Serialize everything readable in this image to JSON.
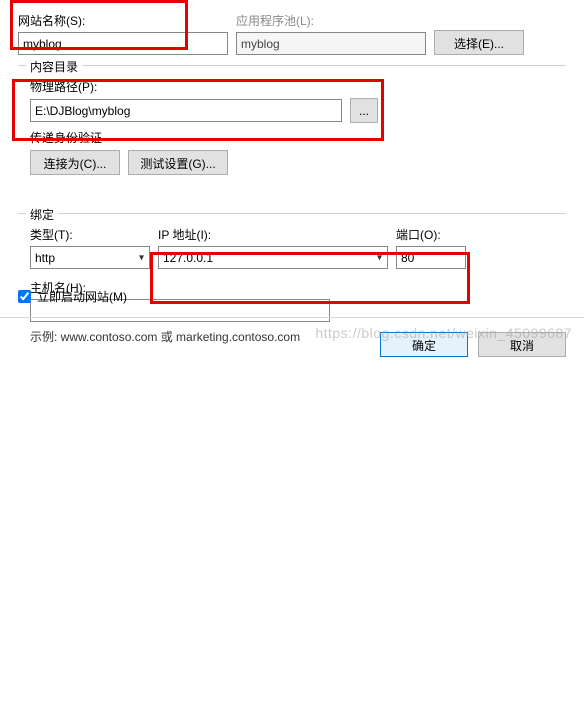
{
  "siteName": {
    "label": "网站名称(S):",
    "value": "myblog"
  },
  "appPool": {
    "label": "应用程序池(L):",
    "value": "myblog",
    "selectBtn": "选择(E)..."
  },
  "content": {
    "groupLabel": "内容目录",
    "pathLabel": "物理路径(P):",
    "pathValue": "E:\\DJBlog\\myblog",
    "browse": "...",
    "authLabel": "传递身份验证",
    "connectAs": "连接为(C)...",
    "testSettings": "测试设置(G)..."
  },
  "binding": {
    "groupLabel": "绑定",
    "typeLabel": "类型(T):",
    "typeValue": "http",
    "ipLabel": "IP 地址(I):",
    "ipValue": "127.0.0.1",
    "portLabel": "端口(O):",
    "portValue": "80",
    "hostLabel": "主机名(H):",
    "hostValue": "",
    "example": "示例: www.contoso.com 或 marketing.contoso.com"
  },
  "startNow": {
    "label": "立即启动网站(M)",
    "checked": true
  },
  "buttons": {
    "ok": "确定",
    "cancel": "取消"
  },
  "watermark": "https://blog.csdn.net/weixin_45099687"
}
